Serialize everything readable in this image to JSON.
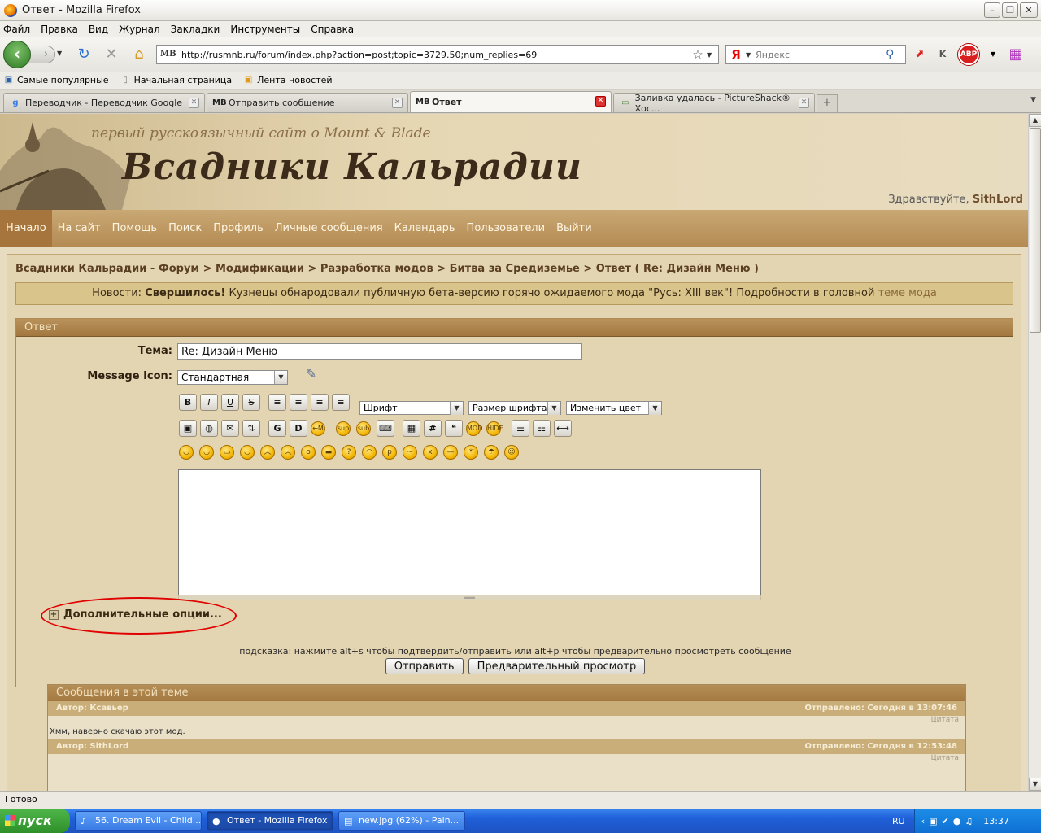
{
  "window": {
    "title": "Ответ - Mozilla Firefox"
  },
  "menu": [
    "Файл",
    "Правка",
    "Вид",
    "Журнал",
    "Закладки",
    "Инструменты",
    "Справка"
  ],
  "nav": {
    "url": "http://rusmnb.ru/forum/index.php?action=post;topic=3729.50;num_replies=69",
    "search_placeholder": "Яндекс",
    "site_icon_text": "MB"
  },
  "bookmarks": [
    "Самые популярные",
    "Начальная страница",
    "Лента новостей"
  ],
  "tabs": [
    {
      "title": "Переводчик - Переводчик Google",
      "icon": "google-icon"
    },
    {
      "title": "Отправить сообщение",
      "icon": "mb-site-icon"
    },
    {
      "title": "Ответ",
      "icon": "mb-site-icon",
      "active": true
    },
    {
      "title": "Заливка удалась - PictureShack® Хос...",
      "icon": "pictureshack-icon"
    }
  ],
  "site": {
    "subtitle": "первый русскоязычный сайт о Mount & Blade",
    "logo": "Всадники Кальрадии",
    "greeting_prefix": "Здравствуйте,",
    "username": "SithLord"
  },
  "mainnav": [
    "Начало",
    "На сайт",
    "Помощь",
    "Поиск",
    "Профиль",
    "Личные сообщения",
    "Календарь",
    "Пользователи",
    "Выйти"
  ],
  "breadcrumb": "Всадники Кальрадии - Форум > Модификации > Разработка модов > Битва за Средиземье > Ответ ( Re: Дизайн Меню )",
  "news": {
    "prefix": "Новости:",
    "bold": "Свершилось!",
    "text": "Кузнецы обнародовали публичную бета-версию горячо ожидаемого мода \"Русь: XIII век\"! Подробности в головной",
    "link": "теме мода"
  },
  "post": {
    "header": "Ответ",
    "subject_label": "Тема:",
    "subject_value": "Re: Дизайн Меню",
    "icon_label": "Message Icon:",
    "icon_value": "Стандартная",
    "font_select": "Шрифт",
    "size_select": "Размер шрифта",
    "color_select": "Изменить цвет",
    "additional_options": "Дополнительные опции...",
    "hint": "подсказка: нажмите alt+s чтобы подтвердить/отправить или alt+p чтобы предварительно просмотреть сообщение",
    "submit": "Отправить",
    "preview": "Предварительный просмотр"
  },
  "topic": {
    "header": "Сообщения в этой теме",
    "posts": [
      {
        "author": "Автор: Ксавьер",
        "sent": "Отправлено: Сегодня в 13:07:46",
        "quote": "Цитата",
        "body": "Хмм, наверно скачаю этот мод."
      },
      {
        "author": "Автор: SithLord",
        "sent": "Отправлено: Сегодня в 12:53:48",
        "quote": "Цитата",
        "body": ""
      }
    ]
  },
  "status": "Готово",
  "taskbar": {
    "start": "пуск",
    "buttons": [
      "56. Dream Evil - Child...",
      "Ответ - Mozilla Firefox",
      "new.jpg (62%) - Pain..."
    ],
    "lang": "RU",
    "clock": "13:37"
  }
}
